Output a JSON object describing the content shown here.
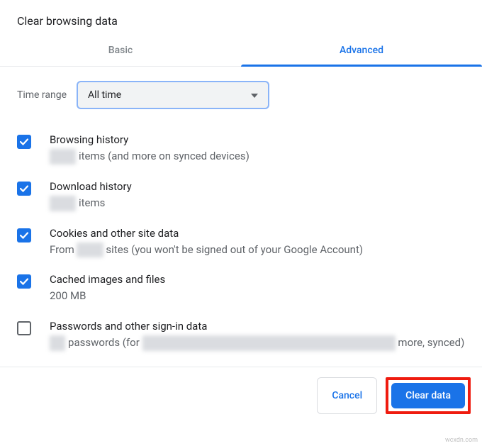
{
  "title": "Clear browsing data",
  "tabs": {
    "basic": "Basic",
    "advanced": "Advanced"
  },
  "time": {
    "label": "Time range",
    "value": "All time"
  },
  "items": {
    "browsing": {
      "title": "Browsing history",
      "sub_after": " items (and more on synced devices)"
    },
    "download": {
      "title": "Download history",
      "sub_after": " items"
    },
    "cookies": {
      "title": "Cookies and other site data",
      "sub_before": "From ",
      "sub_after": " sites (you won't be signed out of your Google Account)"
    },
    "cache": {
      "title": "Cached images and files",
      "sub": "200 MB"
    },
    "passwords": {
      "title": "Passwords and other sign-in data",
      "sub_mid": " passwords (for ",
      "sub_after": " more, synced)"
    }
  },
  "buttons": {
    "cancel": "Cancel",
    "clear": "Clear data"
  },
  "watermark": "wcxdn.com"
}
